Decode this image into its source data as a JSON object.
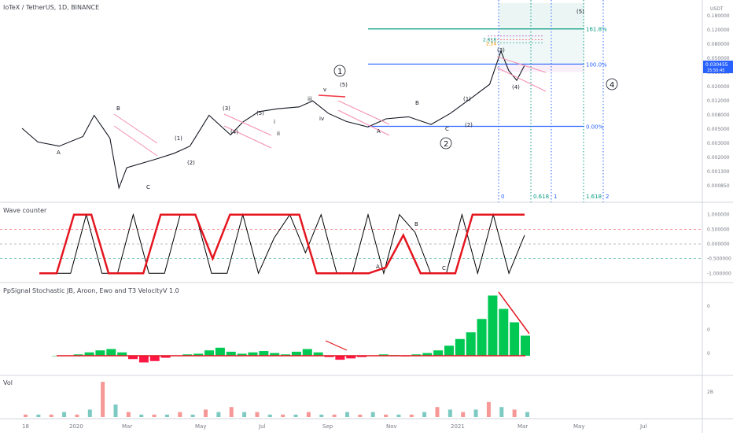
{
  "symbol_title": "IoTeX / TetherUS, 1D, BINANCE",
  "currency": "USDT",
  "price_badge": {
    "price": "0.030455",
    "countdown": "15:50:45"
  },
  "price_axis_ticks": [
    "0.180000",
    "0.120000",
    "0.080000",
    "0.050000",
    "0.030000",
    "0.020000",
    "0.012000",
    "0.008000",
    "0.005000",
    "0.003000",
    "0.002000",
    "0.001300",
    "0.000850"
  ],
  "time_axis_ticks": [
    "18",
    "2020",
    "Mar",
    "May",
    "Jul",
    "Sep",
    "Nov",
    "2021",
    "Mar",
    "May",
    "Jul"
  ],
  "fib": {
    "retracement": [
      {
        "label": "161.8%",
        "price": 0.08,
        "color": "#089981"
      },
      {
        "label": "100.0%",
        "price": 0.031,
        "color": "#2962ff"
      },
      {
        "label": "0.00%",
        "price": 0.0058,
        "color": "#2962ff"
      }
    ],
    "extension_labels": [
      "2.618",
      "2.24"
    ],
    "time_zones": [
      "0",
      "0.618",
      "1",
      "1.618",
      "2"
    ]
  },
  "wave_labels": {
    "circled": [
      "1",
      "2",
      "4"
    ],
    "top_right": [
      "(5)"
    ],
    "minor": [
      "A",
      "B",
      "C",
      "(1)",
      "(2)",
      "(3)",
      "(4)",
      "(5)",
      "i",
      "ii",
      "iii",
      "iv",
      "v",
      "A",
      "B",
      "C",
      "(1)",
      "(2)",
      "(3)",
      "(4)"
    ]
  },
  "chart_data": [
    {
      "type": "line",
      "title": "IoTeX / TetherUS, 1D, BINANCE",
      "y_scale": "log",
      "ylim": [
        0.0007,
        0.18
      ],
      "x": [
        "2019-12-18",
        "2020-01-01",
        "2020-01-20",
        "2020-02-10",
        "2020-02-20",
        "2020-03-05",
        "2020-03-13",
        "2020-03-20",
        "2020-04-15",
        "2020-05-01",
        "2020-05-15",
        "2020-06-01",
        "2020-06-20",
        "2020-07-01",
        "2020-07-15",
        "2020-08-01",
        "2020-08-20",
        "2020-09-01",
        "2020-09-15",
        "2020-10-01",
        "2020-10-20",
        "2020-11-05",
        "2020-11-25",
        "2020-12-15",
        "2021-01-01",
        "2021-01-20",
        "2021-02-05",
        "2021-02-15",
        "2021-02-22",
        "2021-03-01",
        "2021-03-08"
      ],
      "values": [
        0.0055,
        0.0038,
        0.0034,
        0.0044,
        0.0078,
        0.0042,
        0.0011,
        0.0019,
        0.0024,
        0.0028,
        0.0034,
        0.0078,
        0.0046,
        0.0065,
        0.0086,
        0.0093,
        0.0098,
        0.0115,
        0.0082,
        0.0066,
        0.0057,
        0.0071,
        0.0075,
        0.0061,
        0.0082,
        0.0125,
        0.018,
        0.044,
        0.026,
        0.02,
        0.03
      ]
    },
    {
      "type": "line",
      "title": "Wave counter",
      "ylim": [
        -1.1,
        1.1
      ],
      "y_ticks": [
        "1.000000",
        "0.500000",
        "0.000000",
        "-0.500000",
        "-1.000000"
      ],
      "series": [
        {
          "name": "",
          "values": [
            -1,
            -1,
            -1,
            1,
            -1,
            -1,
            1,
            -1,
            -1,
            1,
            1,
            -1,
            -1,
            1,
            -1,
            0.2,
            1,
            -0.3,
            1,
            -1,
            -1,
            1,
            -1,
            1,
            0.4,
            -1,
            -1,
            1,
            -1,
            1,
            -1,
            0.3
          ]
        },
        {
          "name": "",
          "values": [
            -1,
            -1,
            1,
            1,
            -1,
            -1,
            -1,
            1,
            1,
            1,
            -0.5,
            1,
            1,
            1,
            1,
            1,
            -1,
            -1,
            -1,
            -1,
            -0.8,
            0.3,
            -1,
            -1,
            -1,
            1,
            1,
            1,
            1
          ]
        }
      ]
    },
    {
      "type": "area",
      "title": "PpSignal Stochastic JB, Aroon, Ewo and T3 VelocityV 1.0",
      "y_ticks": [
        "0",
        "0",
        "0"
      ],
      "values": [
        0,
        0,
        0.02,
        0.05,
        0.08,
        0.1,
        0.05,
        -0.05,
        -0.1,
        -0.08,
        -0.03,
        0,
        0.02,
        0.03,
        0.08,
        0.12,
        0.06,
        0.03,
        0.05,
        0.07,
        0.04,
        0.02,
        0.06,
        0.1,
        0.05,
        -0.02,
        -0.06,
        -0.04,
        -0.02,
        0,
        0.02,
        0.01,
        -0.01,
        0.02,
        0.04,
        0.08,
        0.15,
        0.25,
        0.35,
        0.55,
        0.9,
        0.7,
        0.5,
        0.3
      ]
    },
    {
      "type": "bar",
      "title": "Vol",
      "y_ticks": [
        "2B"
      ],
      "values": [
        1,
        1,
        1,
        2,
        1,
        3,
        14,
        5,
        2,
        1,
        1,
        1,
        2,
        1,
        3,
        2,
        4,
        2,
        2,
        1,
        1,
        1,
        2,
        1,
        1,
        2,
        1,
        2,
        1,
        1,
        1,
        2,
        4,
        3,
        2,
        3,
        6,
        4,
        3,
        2
      ]
    }
  ]
}
